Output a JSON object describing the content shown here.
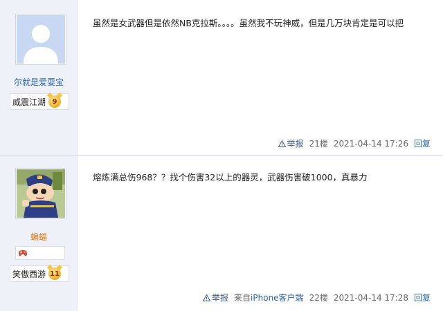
{
  "posts": [
    {
      "username": "尔就是爱耍宝",
      "level_title": "威震江湖",
      "level_number": "9",
      "content": "虽然是女武器但是依然NB克拉斯。。。。虽然我不玩神威，但是几万块肯定是可以把",
      "report_label": "举报",
      "source_prefix": "",
      "source_app": "",
      "source_suffix": "",
      "floor": "21楼",
      "datetime": "2021-04-14 17:26",
      "reply_label": "回复"
    },
    {
      "username": "蝙蝠",
      "level_title": "笑傲西游",
      "level_number": "11",
      "content": "熔炼满总伤968？？找个伤害32以上的器灵，武器伤害破1000，真暴力",
      "report_label": "举报",
      "source_prefix": "来自",
      "source_app": "iPhone客户端",
      "source_suffix": "",
      "floor": "22楼",
      "datetime": "2021-04-14 17:28",
      "reply_label": "回复"
    }
  ],
  "colors": {
    "sidebar_bg": "#eef1f8",
    "link_blue": "#2a65b0",
    "vip_orange": "#e07a18"
  }
}
